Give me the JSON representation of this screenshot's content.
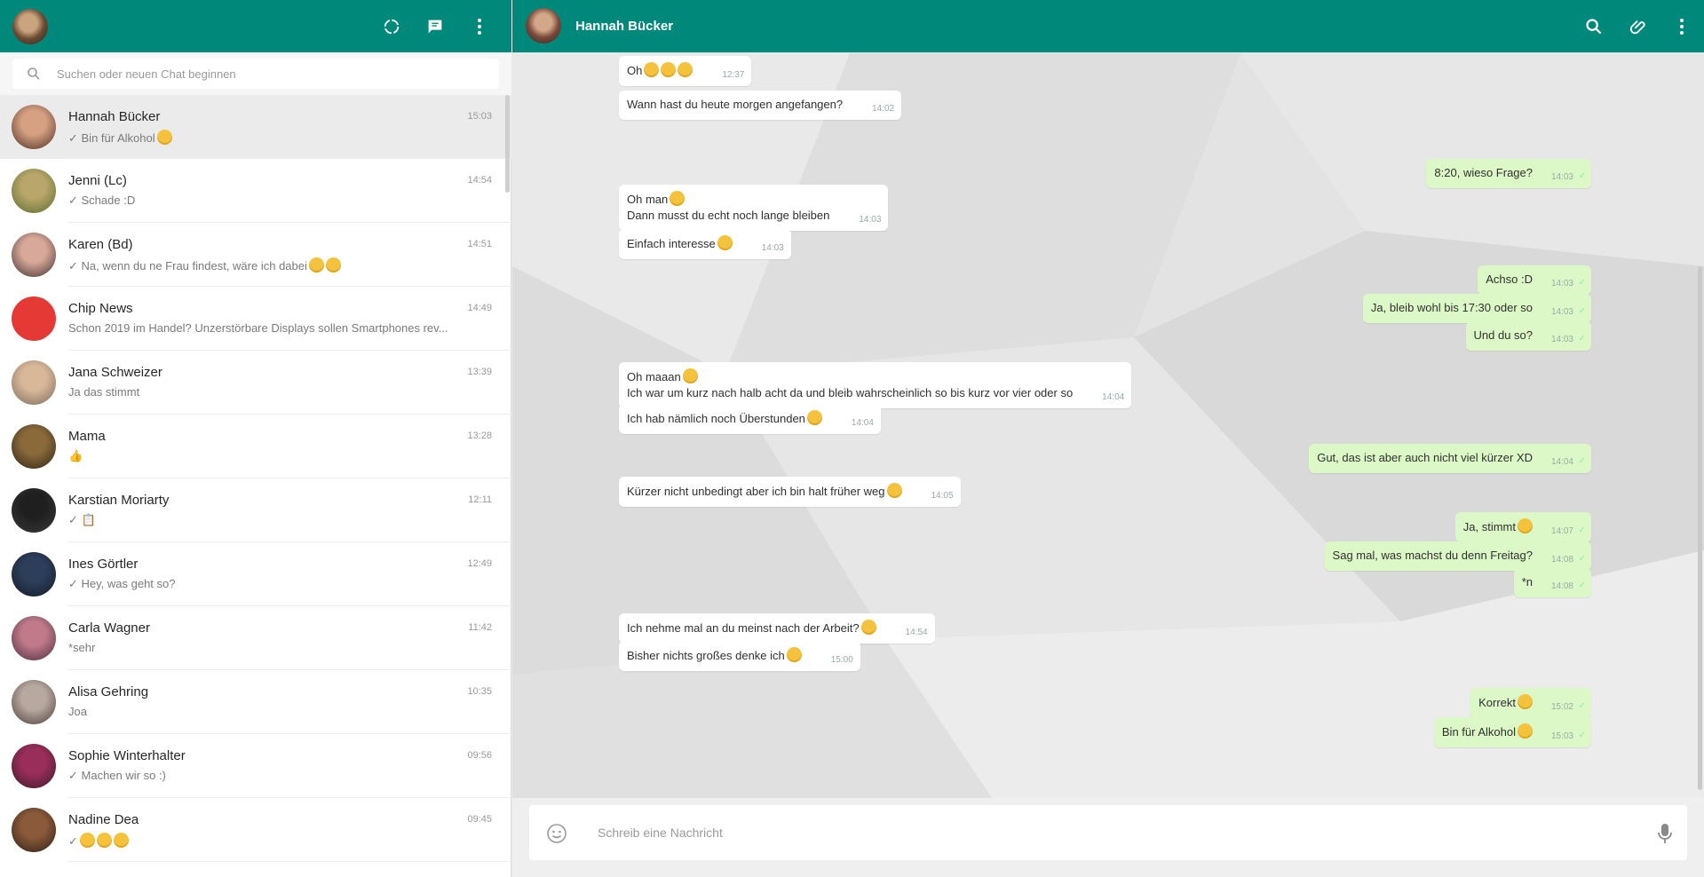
{
  "search": {
    "placeholder": "Suchen oder neuen Chat beginnen"
  },
  "chats": [
    {
      "name": "Hannah Bücker",
      "time": "15:03",
      "preview": "✓ Bin für Alkohol",
      "emoji": 1
    },
    {
      "name": "Jenni (Lc)",
      "time": "14:54",
      "preview": "✓ Schade :D",
      "emoji": 0
    },
    {
      "name": "Karen (Bd)",
      "time": "14:51",
      "preview": "✓ Na, wenn du ne Frau findest, wäre ich dabei",
      "emoji": 2
    },
    {
      "name": "Chip News",
      "time": "14:49",
      "preview": "Schon 2019 im Handel? Unzerstörbare Displays sollen Smartphones rev...",
      "emoji": 0
    },
    {
      "name": "Jana Schweizer",
      "time": "13:39",
      "preview": "Ja das stimmt",
      "emoji": 0
    },
    {
      "name": "Mama",
      "time": "13:28",
      "preview": "👍",
      "emoji": 0
    },
    {
      "name": "Karstian Moriarty",
      "time": "12:11",
      "preview": "✓ 📋",
      "emoji": 0
    },
    {
      "name": "Ines Görtler",
      "time": "12:49",
      "preview": "✓ Hey, was geht so?",
      "emoji": 0
    },
    {
      "name": "Carla Wagner",
      "time": "11:42",
      "preview": "*sehr",
      "emoji": 0
    },
    {
      "name": "Alisa Gehring",
      "time": "10:35",
      "preview": "Joa",
      "emoji": 0
    },
    {
      "name": "Sophie Winterhalter",
      "time": "09:56",
      "preview": "✓ Machen wir so :)",
      "emoji": 0
    },
    {
      "name": "Nadine Dea",
      "time": "09:45",
      "preview": "✓",
      "emoji": 3
    }
  ],
  "conversation": {
    "contact_name": "Hannah Bücker",
    "messages": [
      {
        "dir": "in",
        "text": "Oh",
        "emoji": 3,
        "time": "12:37"
      },
      {
        "dir": "in",
        "text": "Wann hast du heute morgen angefangen?",
        "emoji": 0,
        "time": "14:02"
      },
      {
        "dir": "out",
        "text": "8:20, wieso Frage?",
        "emoji": 0,
        "time": "14:03"
      },
      {
        "dir": "in",
        "text": "Oh man",
        "text2": "Dann musst du echt noch lange bleiben",
        "emoji": 1,
        "time": "14:03"
      },
      {
        "dir": "in",
        "text": "Einfach interesse",
        "emoji": 1,
        "time": "14:03"
      },
      {
        "dir": "out",
        "text": "Achso :D",
        "emoji": 0,
        "time": "14:03"
      },
      {
        "dir": "out",
        "text": "Ja, bleib wohl bis 17:30 oder so",
        "emoji": 0,
        "time": "14:03"
      },
      {
        "dir": "out",
        "text": "Und du so?",
        "emoji": 0,
        "time": "14:03"
      },
      {
        "dir": "in",
        "text": "Oh maaan",
        "text2": "Ich war um kurz nach halb acht da und bleib wahrscheinlich so bis kurz vor vier oder so",
        "emoji": 1,
        "time": "14:04"
      },
      {
        "dir": "in",
        "text": "Ich hab nämlich noch Überstunden",
        "emoji": 1,
        "time": "14:04"
      },
      {
        "dir": "out",
        "text": "Gut, das ist aber auch nicht viel kürzer XD",
        "emoji": 0,
        "time": "14:04"
      },
      {
        "dir": "in",
        "text": "Kürzer nicht unbedingt aber ich bin halt früher weg",
        "emoji": 1,
        "time": "14:05"
      },
      {
        "dir": "out",
        "text": "Ja, stimmt",
        "emoji": 1,
        "time": "14:07"
      },
      {
        "dir": "out",
        "text": "Sag mal, was machst du denn Freitag?",
        "emoji": 0,
        "time": "14:08"
      },
      {
        "dir": "out",
        "text": "*n",
        "emoji": 0,
        "time": "14:08"
      },
      {
        "dir": "in",
        "text": "Ich nehme mal an du meinst nach der Arbeit?",
        "emoji": 1,
        "time": "14:54"
      },
      {
        "dir": "in",
        "text": "Bisher nichts großes denke ich",
        "emoji": 1,
        "time": "15:00"
      },
      {
        "dir": "out",
        "text": "Korrekt",
        "emoji": 1,
        "time": "15:02"
      },
      {
        "dir": "out",
        "text": "Bin für Alkohol",
        "emoji": 1,
        "time": "15:03"
      }
    ]
  },
  "composer": {
    "placeholder": "Schreib eine Nachricht"
  },
  "colors": {
    "header": "#00897b",
    "outgoing": "#dcf8c6",
    "incoming": "#ffffff"
  },
  "icons": [
    "status-icon",
    "new-chat-icon",
    "menu-icon",
    "search-icon",
    "attach-icon",
    "emoji-icon",
    "microphone-icon"
  ]
}
